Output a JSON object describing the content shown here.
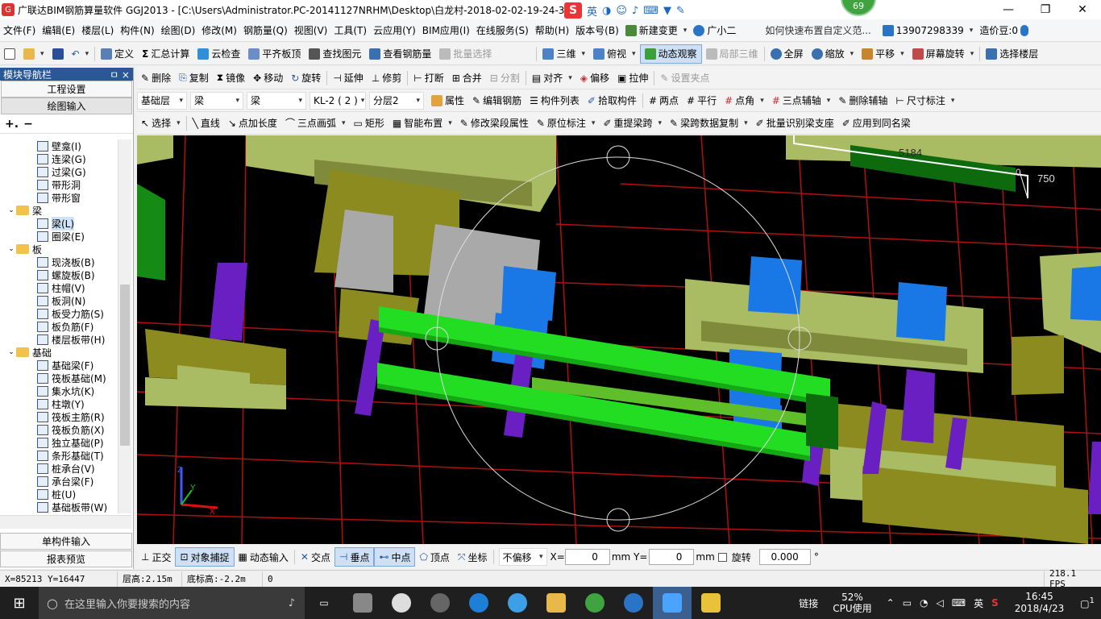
{
  "window": {
    "title": "广联达BIM钢筋算量软件 GGJ2013 - [C:\\Users\\Administrator.PC-20141127NRHM\\Desktop\\白龙村-2018-02-02-19-24-35",
    "ime_mode": "英",
    "badge": "69"
  },
  "menu": {
    "items": [
      "文件(F)",
      "编辑(E)",
      "楼层(L)",
      "构件(N)",
      "绘图(D)",
      "修改(M)",
      "钢筋量(Q)",
      "视图(V)",
      "工具(T)",
      "云应用(Y)",
      "BIM应用(I)",
      "在线服务(S)",
      "帮助(H)",
      "版本号(B)"
    ],
    "new_change": "新建变更",
    "xiaoer": "广小二",
    "help_link": "如何快速布置自定义范...",
    "phone": "13907298339",
    "price_beans": "造价豆:0"
  },
  "toolbar1": {
    "define": "定义",
    "sum": "汇总计算",
    "cloud_check": "云检查",
    "align_top": "平齐板顶",
    "find": "查找图元",
    "view_rebar": "查看钢筋量",
    "batch_select": "批量选择",
    "three_d": "三维",
    "top_view": "俯视",
    "dynamic_view": "动态观察",
    "local_3d": "局部三维",
    "full_screen": "全屏",
    "zoom": "缩放",
    "pan": "平移",
    "screen_rotate": "屏幕旋转",
    "select_floor": "选择楼层"
  },
  "toolbar2": {
    "delete": "删除",
    "copy": "复制",
    "mirror": "镜像",
    "move": "移动",
    "rotate": "旋转",
    "extend": "延伸",
    "trim": "修剪",
    "break": "打断",
    "merge": "合并",
    "split": "分割",
    "align": "对齐",
    "offset": "偏移",
    "stretch": "拉伸",
    "set_grip": "设置夹点"
  },
  "toolbar3": {
    "layer": "基础层",
    "type1": "梁",
    "type2": "梁",
    "component": "KL-2 ( 2 )",
    "sublayer": "分层2",
    "property": "属性",
    "edit_rebar": "编辑钢筋",
    "comp_list": "构件列表",
    "pick": "拾取构件",
    "two_point": "两点",
    "parallel": "平行",
    "point_angle": "点角",
    "three_point_axis": "三点辅轴",
    "del_axis": "删除辅轴",
    "dimension": "尺寸标注"
  },
  "toolbar4": {
    "select": "选择",
    "line": "直线",
    "point_len": "点加长度",
    "arc": "三点画弧",
    "rect": "矩形",
    "smart": "智能布置",
    "modify_seg": "修改梁段属性",
    "orig_label": "原位标注",
    "reextract": "重提梁跨",
    "span_copy": "梁跨数据复制",
    "batch_support": "批量识别梁支座",
    "apply_same": "应用到同名梁"
  },
  "sidebar": {
    "title": "模块导航栏",
    "pin": "ㅁ ×",
    "project_settings": "工程设置",
    "drawing_input": "绘图输入",
    "tree": [
      {
        "label": "壁龛(I)",
        "level": 2,
        "kind": "item"
      },
      {
        "label": "连梁(G)",
        "level": 2,
        "kind": "item"
      },
      {
        "label": "过梁(G)",
        "level": 2,
        "kind": "item"
      },
      {
        "label": "带形洞",
        "level": 2,
        "kind": "item"
      },
      {
        "label": "带形窗",
        "level": 2,
        "kind": "item"
      },
      {
        "label": "梁",
        "level": 1,
        "kind": "folder"
      },
      {
        "label": "梁(L)",
        "level": 2,
        "kind": "item",
        "selected": true
      },
      {
        "label": "圈梁(E)",
        "level": 2,
        "kind": "item"
      },
      {
        "label": "板",
        "level": 1,
        "kind": "folder"
      },
      {
        "label": "现浇板(B)",
        "level": 2,
        "kind": "item"
      },
      {
        "label": "螺旋板(B)",
        "level": 2,
        "kind": "item"
      },
      {
        "label": "柱帽(V)",
        "level": 2,
        "kind": "item"
      },
      {
        "label": "板洞(N)",
        "level": 2,
        "kind": "item"
      },
      {
        "label": "板受力筋(S)",
        "level": 2,
        "kind": "item"
      },
      {
        "label": "板负筋(F)",
        "level": 2,
        "kind": "item"
      },
      {
        "label": "楼层板带(H)",
        "level": 2,
        "kind": "item"
      },
      {
        "label": "基础",
        "level": 1,
        "kind": "folder"
      },
      {
        "label": "基础梁(F)",
        "level": 2,
        "kind": "item"
      },
      {
        "label": "筏板基础(M)",
        "level": 2,
        "kind": "item"
      },
      {
        "label": "集水坑(K)",
        "level": 2,
        "kind": "item"
      },
      {
        "label": "柱墩(Y)",
        "level": 2,
        "kind": "item"
      },
      {
        "label": "筏板主筋(R)",
        "level": 2,
        "kind": "item"
      },
      {
        "label": "筏板负筋(X)",
        "level": 2,
        "kind": "item"
      },
      {
        "label": "独立基础(P)",
        "level": 2,
        "kind": "item"
      },
      {
        "label": "条形基础(T)",
        "level": 2,
        "kind": "item"
      },
      {
        "label": "桩承台(V)",
        "level": 2,
        "kind": "item"
      },
      {
        "label": "承台梁(F)",
        "level": 2,
        "kind": "item"
      },
      {
        "label": "桩(U)",
        "level": 2,
        "kind": "item"
      },
      {
        "label": "基础板带(W)",
        "level": 2,
        "kind": "item"
      }
    ],
    "single_input": "单构件输入",
    "report": "报表预览"
  },
  "viewport": {
    "dim1": "5184",
    "dim2": "750",
    "dim3": "0",
    "axis_z": "Z",
    "axis_y": "Y",
    "axis_x": "X"
  },
  "snapbar": {
    "ortho": "正交",
    "snap": "对象捕捉",
    "dyn_input": "动态输入",
    "intersect": "交点",
    "perp": "垂点",
    "mid": "中点",
    "vertex": "顶点",
    "coord": "坐标",
    "offset_mode": "不偏移",
    "x_label": "X=",
    "x_val": "0",
    "y_label": "mm Y=",
    "y_val": "0",
    "mm": "mm",
    "rotate_label": "旋转",
    "rotate_val": "0.000",
    "deg": "°"
  },
  "status": {
    "coords": "X=85213 Y=16447",
    "floor_height": "层高:2.15m",
    "bottom_height": "底标高:-2.2m",
    "value": "0",
    "fps": "218.1 FPS"
  },
  "taskbar": {
    "search_placeholder": "在这里输入你要搜索的内容",
    "link": "链接",
    "cpu_pct": "52%",
    "cpu_label": "CPU使用",
    "lang": "英",
    "time": "16:45",
    "date": "2018/4/23",
    "notif": "1"
  },
  "colors": {
    "slab_green": "#a9bb63",
    "olive": "#8b8b20",
    "beam_green": "#22dd22",
    "column_purple": "#6a1fc2",
    "blue_block": "#1a78e6",
    "grey_block": "#a9a9a9",
    "grid_red": "#b01010",
    "accent": "#2b5797"
  }
}
